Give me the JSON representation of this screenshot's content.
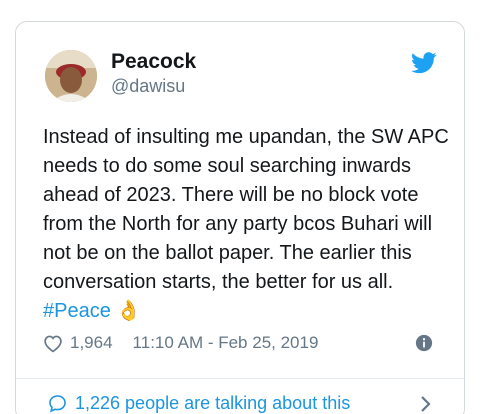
{
  "author": {
    "name": "Peacock",
    "handle": "@dawisu",
    "avatar_icon": "avatar-photo"
  },
  "brand": {
    "icon": "twitter-bird-icon",
    "color": "#1da1f2"
  },
  "tweet": {
    "text": "Instead of insulting me upandan, the SW APC needs to do some soul searching inwards ahead of 2023. There will be no block vote from the North for any party bcos Buhari will not be on the ballot paper. The earlier this conversation starts, the better for us all.",
    "hashtag": "#Peace",
    "emoji": "👌"
  },
  "meta": {
    "likes": "1,964",
    "timestamp": "11:10 AM - Feb 25, 2019",
    "like_icon": "heart-icon",
    "info_icon": "info-icon"
  },
  "conversation": {
    "label": "1,226 people are talking about this",
    "icon": "speech-bubble-icon",
    "chevron_icon": "chevron-right-icon"
  },
  "colors": {
    "link": "#1b95e0",
    "secondary_text": "#657786",
    "border": "#d4d9de"
  }
}
